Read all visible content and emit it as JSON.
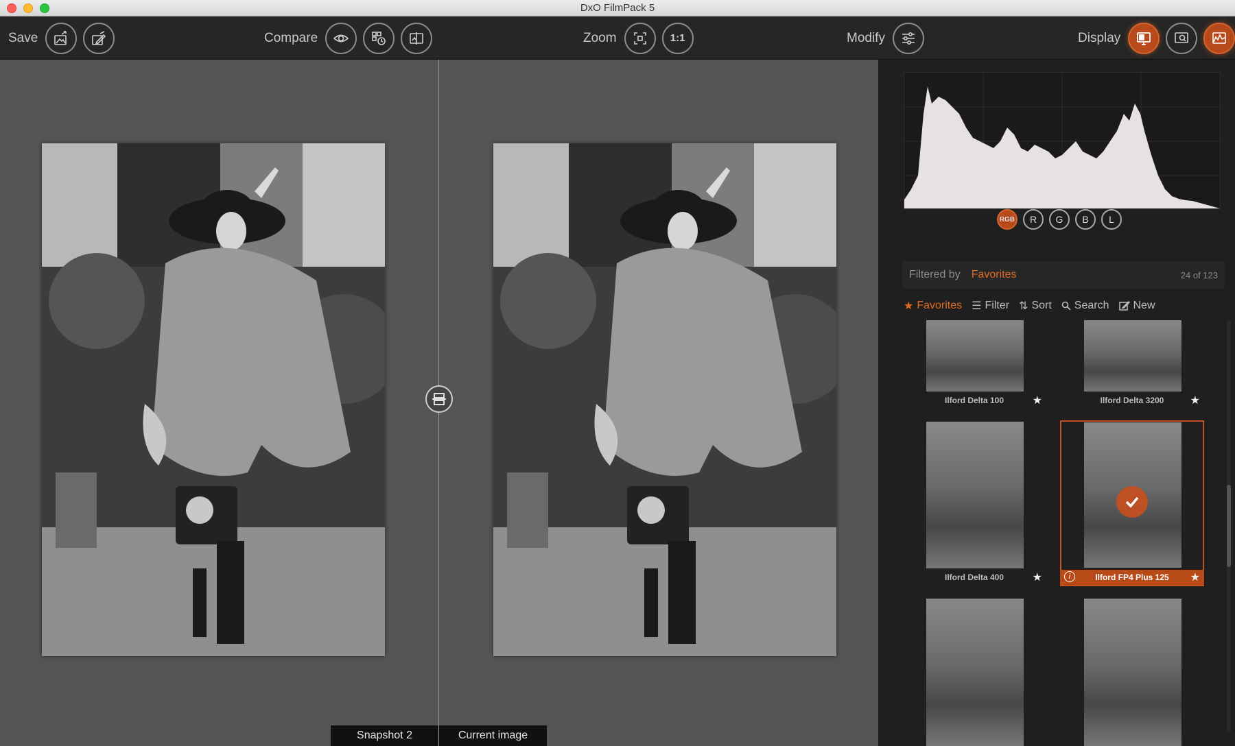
{
  "window": {
    "title": "DxO FilmPack 5"
  },
  "toolbar": {
    "save_label": "Save",
    "compare_label": "Compare",
    "zoom_label": "Zoom",
    "zoom_11": "1:1",
    "modify_label": "Modify",
    "display_label": "Display"
  },
  "preview": {
    "left_caption": "Snapshot 2",
    "right_caption": "Current image"
  },
  "histogram": {
    "channels": [
      "RGB",
      "R",
      "G",
      "B",
      "L"
    ],
    "active_channel": "RGB"
  },
  "browser": {
    "filtered_by_label": "Filtered by",
    "filter_value": "Favorites",
    "count": "24 of 123",
    "actions": {
      "favorites": "Favorites",
      "filter": "Filter",
      "sort": "Sort",
      "search": "Search",
      "new": "New"
    },
    "films": [
      {
        "name": "Ilford Delta 100",
        "favorite": true
      },
      {
        "name": "Ilford Delta 3200",
        "favorite": true
      },
      {
        "name": "Ilford Delta 400",
        "favorite": true
      },
      {
        "name": "Ilford FP4 Plus 125",
        "favorite": true,
        "selected": true
      },
      {
        "name": "",
        "favorite": true
      },
      {
        "name": "",
        "favorite": true
      }
    ]
  },
  "colors": {
    "accent": "#d3632b",
    "background": "#555555",
    "panel": "#1f1f1f"
  }
}
